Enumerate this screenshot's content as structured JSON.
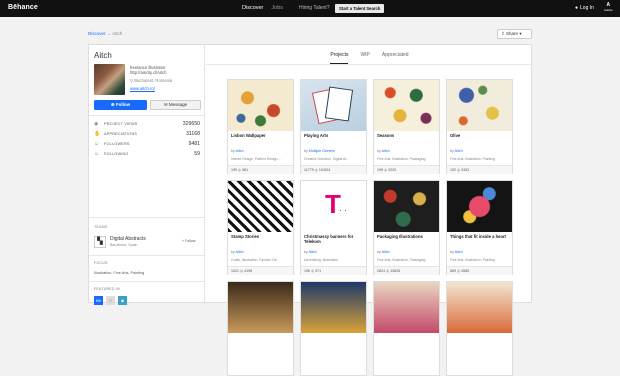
{
  "topbar": {
    "logo": "Bēhance",
    "nav": [
      "Discover",
      "Jobs"
    ],
    "hiring": "Hiring Talent?",
    "talent_button": "Start a Talent Search",
    "login": "Log In",
    "adobe": "A",
    "adobe_sub": "Adobe"
  },
  "breadcrumb": {
    "discover": "Discover",
    "sep": "→",
    "current": "Aitch"
  },
  "share": {
    "label": "Share",
    "icon": "share-icon"
  },
  "profile": {
    "name": "Aitch",
    "bio_line1": "freelance illustrator",
    "bio_line2": "http://aiscity.cl/Aitch",
    "location": "Bucharest, Romania",
    "website": "www.aitch.ro/",
    "follow_label": "Follow",
    "message_label": "Message"
  },
  "stats": [
    {
      "label": "Project Views",
      "value": "329650",
      "icon": "eye-icon"
    },
    {
      "label": "Appreciations",
      "value": "31168",
      "icon": "thumb-icon"
    },
    {
      "label": "Followers",
      "value": "9481",
      "icon": "user-icon"
    },
    {
      "label": "Following",
      "value": "59",
      "icon": "user-icon"
    }
  ],
  "teams": {
    "title": "Teams",
    "name": "Digital Abstracts",
    "location": "Barcelona, Spain",
    "follow": "+ Follow"
  },
  "focus": {
    "title": "Focus",
    "text": "Illustration, Fine Arts, Painting"
  },
  "featured": {
    "title": "Featured In"
  },
  "web": {
    "title": "On The Web"
  },
  "tabs": [
    "Projects",
    "WIP",
    "Appreciated"
  ],
  "projects": [
    {
      "title": "Lisbon Wallpaper",
      "by": "Aitch",
      "fields": "Interior Design, Pattern Design,...",
      "stats": "199   ◎ 981"
    },
    {
      "title": "Playing Arts",
      "by": "Multiple Owners",
      "fields": "Creative Direction, Digital Ar...",
      "stats": "11779   ◎ 104011"
    },
    {
      "title": "Seasons",
      "by": "Aitch",
      "fields": "Fine Arts, Illustration, Packaging",
      "stats": "199   ◎ 3220"
    },
    {
      "title": "Olive",
      "by": "Aitch",
      "fields": "Fine Arts, Illustration, Painting",
      "stats": "192   ◎ 2453"
    },
    {
      "title": "Stamp Stories",
      "by": "Aitch",
      "fields": "Crafts, Illustration, Fashion De...",
      "stats": "1021   ◎ 4198"
    },
    {
      "title": "Christmassy banners for Telekom",
      "by": "Aitch",
      "fields": "Advertising, Illustration",
      "stats": "196   ◎ 971"
    },
    {
      "title": "Packaging Illustrations",
      "by": "Aitch",
      "fields": "Fine Arts, Illustration, Packaging",
      "stats": "2824   ◎ 13625"
    },
    {
      "title": "Things that fit inside a heart",
      "by": "Aitch",
      "fields": "Fine Arts, Illustration, Painting",
      "stats": "569   ◎ 2685"
    }
  ]
}
